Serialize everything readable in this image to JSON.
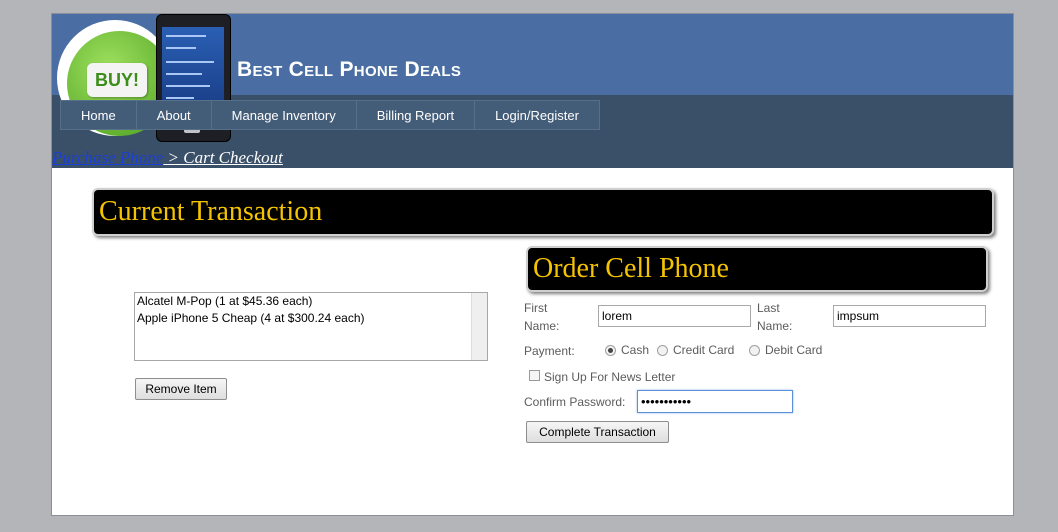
{
  "header": {
    "site_title": "Best Cell Phone Deals",
    "logo_text": "BUY!"
  },
  "nav": {
    "items": [
      "Home",
      "About",
      "Manage Inventory",
      "Billing Report",
      "Login/Register"
    ]
  },
  "breadcrumb": {
    "link": "Purchase Phone",
    "current": " > Cart Checkout"
  },
  "current_transaction": {
    "title": "Current Transaction",
    "items": [
      "Alcatel M-Pop (1 at $45.36 each)",
      "Apple iPhone 5 Cheap (4 at $300.24 each)"
    ],
    "remove_button": "Remove Item"
  },
  "order": {
    "title": "Order Cell Phone",
    "first_name_label_1": "First",
    "first_name_label_2": "Name:",
    "first_name_value": "lorem",
    "last_name_label_1": "Last",
    "last_name_label_2": "Name:",
    "last_name_value": "impsum",
    "payment_label": "Payment:",
    "payment_options": [
      "Cash",
      "Credit Card",
      "Debit Card"
    ],
    "payment_selected": "Cash",
    "newsletter_label": "Sign Up For News Letter",
    "confirm_password_label": "Confirm Password:",
    "confirm_password_value": "•••••••••••",
    "complete_button": "Complete Transaction"
  },
  "colors": {
    "header_blue": "#4a6ea3",
    "nav_dark": "#3a5069",
    "banner_text": "#f5c400",
    "link_blue": "#1a3fd6"
  }
}
